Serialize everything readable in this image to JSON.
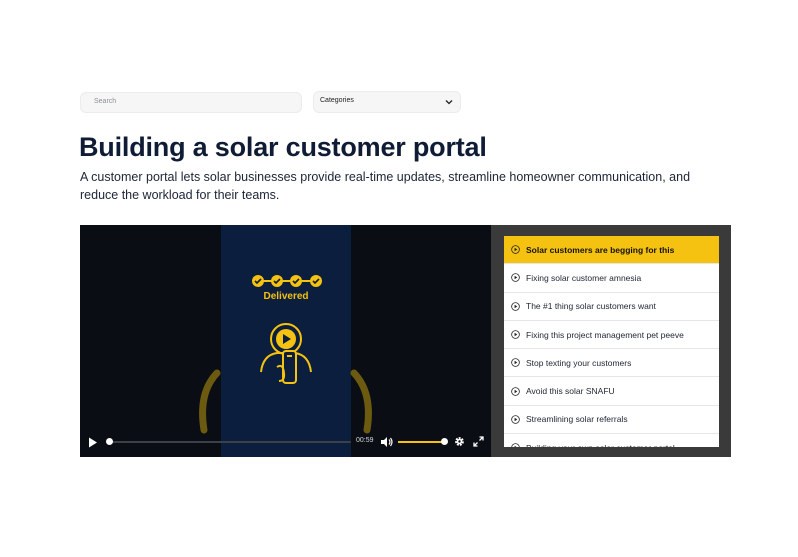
{
  "filters": {
    "search_placeholder": "Search",
    "categories_label": "Categories"
  },
  "article": {
    "title": "Building a solar customer portal",
    "description": "A customer portal lets solar businesses provide real-time updates, streamline homeowner communication, and reduce the workload for their teams."
  },
  "video": {
    "overlay_text": "Delivered",
    "time": "00:59",
    "progress_fraction": 0.0,
    "volume_fraction": 1.0,
    "accent_color": "#f5c211"
  },
  "playlist": {
    "items": [
      {
        "label": "Solar customers are begging for this",
        "active": true
      },
      {
        "label": "Fixing solar customer amnesia",
        "active": false
      },
      {
        "label": "The #1 thing solar customers want",
        "active": false
      },
      {
        "label": "Fixing this project management pet peeve",
        "active": false
      },
      {
        "label": "Stop texting your customers",
        "active": false
      },
      {
        "label": "Avoid this solar SNAFU",
        "active": false
      },
      {
        "label": "Streamlining solar referrals",
        "active": false
      },
      {
        "label": "Building your own solar customer portal",
        "active": false
      }
    ]
  }
}
